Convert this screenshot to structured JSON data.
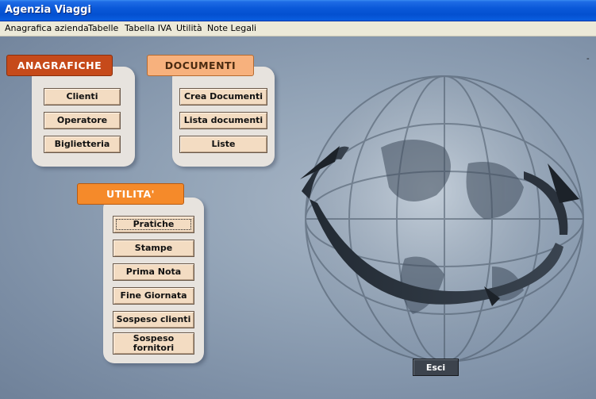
{
  "window": {
    "title": "Agenzia Viaggi"
  },
  "menu": [
    {
      "label": "Anagrafica azienda"
    },
    {
      "label": "Tabelle"
    },
    {
      "label": "Tabella IVA"
    },
    {
      "label": "Utilità"
    },
    {
      "label": "Note Legali"
    }
  ],
  "corner_mark": "-",
  "anagrafiche": {
    "title": "ANAGRAFICHE",
    "buttons": [
      "Clienti",
      "Operatore",
      "Biglietteria"
    ]
  },
  "documenti": {
    "title": "DOCUMENTI",
    "buttons": [
      "Crea Documenti",
      "Lista documenti",
      "Liste"
    ]
  },
  "utilita": {
    "title": "UTILITA'",
    "buttons": [
      "Pratiche",
      "Stampe",
      "Prima Nota",
      "Fine Giornata",
      "Sospeso clienti",
      "Sospeso fornitori"
    ]
  },
  "exit_label": "Esci",
  "colors": {
    "titlebar": "#0a58d8",
    "anagrafiche_tag": "#c64a1a",
    "documenti_tag": "#f7b17d",
    "utilita_tag": "#f58a2a",
    "button_face": "#f3dcc2",
    "exit_button": "#3c434d"
  }
}
